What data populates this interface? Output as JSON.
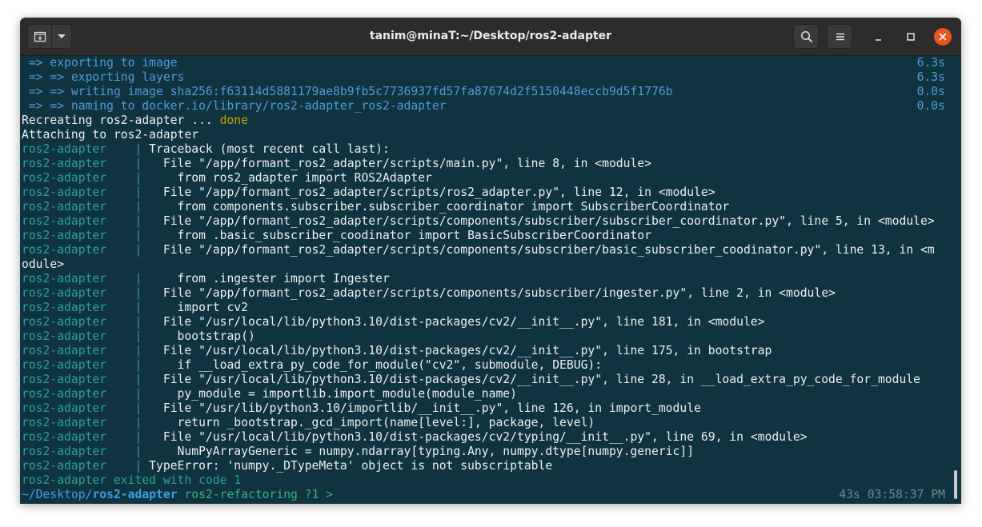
{
  "window": {
    "title": "tanim@minaT:~/Desktop/ros2-adapter"
  },
  "icons": {
    "new_tab": "new-tab-icon",
    "tab_menu": "chevron-down-icon",
    "search": "search-icon",
    "menu": "hamburger-menu-icon",
    "minimize": "minimize-icon",
    "maximize": "maximize-icon",
    "close": "close-icon"
  },
  "colors": {
    "terminal_bg": "#0f3440",
    "titlebar_bg": "#2c2c2c",
    "close_button": "#e95420",
    "build_text": "#4f9bd9",
    "service_prefix": "#2aa198",
    "done_text": "#c4a000"
  },
  "build_steps": [
    {
      "text": " => exporting to image",
      "time": "6.3s"
    },
    {
      "text": " => => exporting layers",
      "time": "6.3s"
    },
    {
      "text": " => => writing image sha256:f63114d5881179ae8b9fb5c7736937fd57fa87674d2f5150448eccb9d5f1776b",
      "time": "0.0s"
    },
    {
      "text": " => => naming to docker.io/library/ros2-adapter_ros2-adapter",
      "time": "0.0s"
    }
  ],
  "recreating": {
    "text": "Recreating ros2-adapter ... ",
    "status": "done"
  },
  "attaching": "Attaching to ros2-adapter",
  "service_prefix": "ros2-adapter    |",
  "log_lines": [
    " Traceback (most recent call last):",
    "   File \"/app/formant_ros2_adapter/scripts/main.py\", line 8, in <module>",
    "     from ros2_adapter import ROS2Adapter",
    "   File \"/app/formant_ros2_adapter/scripts/ros2_adapter.py\", line 12, in <module>",
    "     from components.subscriber.subscriber_coordinator import SubscriberCoordinator",
    "   File \"/app/formant_ros2_adapter/scripts/components/subscriber/subscriber_coordinator.py\", line 5, in <module>",
    "     from .basic_subscriber_coodinator import BasicSubscriberCoordinator",
    "   File \"/app/formant_ros2_adapter/scripts/components/subscriber/basic_subscriber_coodinator.py\", line 13, in <m"
  ],
  "wrapped_continuation": "odule>",
  "log_lines_2": [
    "     from .ingester import Ingester",
    "   File \"/app/formant_ros2_adapter/scripts/components/subscriber/ingester.py\", line 2, in <module>",
    "     import cv2",
    "   File \"/usr/local/lib/python3.10/dist-packages/cv2/__init__.py\", line 181, in <module>",
    "     bootstrap()",
    "   File \"/usr/local/lib/python3.10/dist-packages/cv2/__init__.py\", line 175, in bootstrap",
    "     if __load_extra_py_code_for_module(\"cv2\", submodule, DEBUG):",
    "   File \"/usr/local/lib/python3.10/dist-packages/cv2/__init__.py\", line 28, in __load_extra_py_code_for_module",
    "     py_module = importlib.import_module(module_name)",
    "   File \"/usr/lib/python3.10/importlib/__init__.py\", line 126, in import_module",
    "     return _bootstrap._gcd_import(name[level:], package, level)",
    "   File \"/usr/local/lib/python3.10/dist-packages/cv2/typing/__init__.py\", line 69, in <module>",
    "     NumPyArrayGeneric = numpy.ndarray[typing.Any, numpy.dtype[numpy.generic]]",
    " TypeError: 'numpy._DTypeMeta' object is not subscriptable"
  ],
  "exit_line": "ros2-adapter exited with code 1",
  "prompt": {
    "dir_prefix": "~/Desktop/",
    "dir_current": "ros2-adapter",
    "branch": " ros2-refactoring",
    "status": " ?1 >",
    "right": "43s 03:58:37 PM"
  }
}
